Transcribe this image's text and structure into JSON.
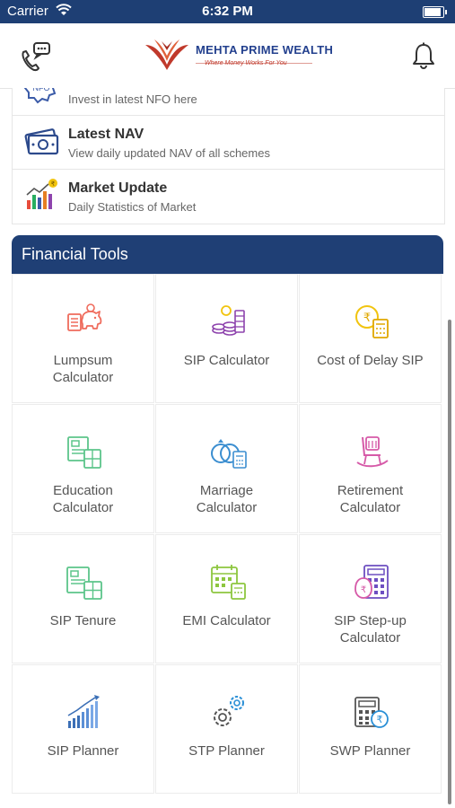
{
  "status_bar": {
    "carrier": "Carrier",
    "time": "6:32 PM"
  },
  "header": {
    "brand_name": "MEHTA PRIME WEALTH",
    "tagline": "Where Money Works For You"
  },
  "services": [
    {
      "icon": "nfo-icon",
      "title": "",
      "subtitle": "Invest in latest NFO here"
    },
    {
      "icon": "nav-icon",
      "title": "Latest NAV",
      "subtitle": "View daily updated NAV of all schemes"
    },
    {
      "icon": "market-update-icon",
      "title": "Market Update",
      "subtitle": "Daily Statistics of Market"
    }
  ],
  "financial_tools": {
    "title": "Financial Tools",
    "tools": [
      {
        "label": "Lumpsum\nCalculator",
        "icon": "piggy-bank-icon"
      },
      {
        "label": "SIP Calculator",
        "icon": "coins-icon"
      },
      {
        "label": "Cost of Delay SIP",
        "icon": "rupee-calculator-icon"
      },
      {
        "label": "Education\nCalculator",
        "icon": "education-calculator-icon"
      },
      {
        "label": "Marriage\nCalculator",
        "icon": "rings-icon"
      },
      {
        "label": "Retirement\nCalculator",
        "icon": "rocking-chair-icon"
      },
      {
        "label": "SIP Tenure",
        "icon": "sip-tenure-icon"
      },
      {
        "label": "EMI Calculator",
        "icon": "calendar-calculator-icon"
      },
      {
        "label": "SIP Step-up\nCalculator",
        "icon": "step-up-calculator-icon"
      },
      {
        "label": "SIP Planner",
        "icon": "bar-graph-icon"
      },
      {
        "label": "STP Planner",
        "icon": "gears-icon"
      },
      {
        "label": "SWP Planner",
        "icon": "swp-calculator-icon"
      }
    ]
  }
}
